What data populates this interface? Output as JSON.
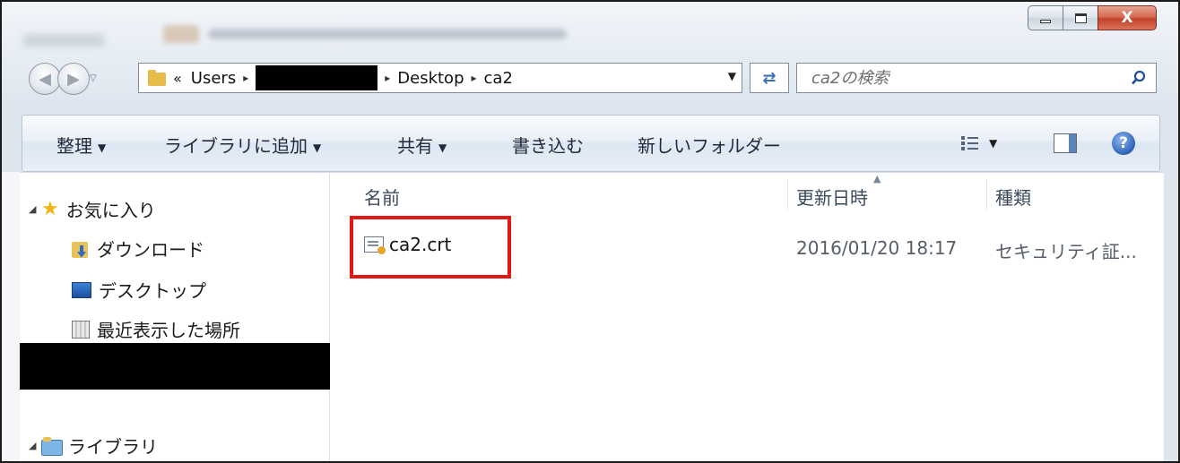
{
  "window": {
    "minimize_label": "",
    "maximize_label": "",
    "close_label": "X"
  },
  "address": {
    "lead": "«",
    "crumbs": [
      "Users",
      "",
      "Desktop",
      "ca2"
    ],
    "separator": "▸"
  },
  "search": {
    "placeholder": "ca2の検索"
  },
  "toolbar": {
    "organize": "整理",
    "add_to_library": "ライブラリに追加",
    "share": "共有",
    "burn": "書き込む",
    "new_folder": "新しいフォルダー",
    "dropdown_glyph": "▼"
  },
  "nav": {
    "favorites": "お気に入り",
    "downloads": "ダウンロード",
    "desktop": "デスクトップ",
    "recent": "最近表示した場所",
    "libraries": "ライブラリ"
  },
  "columns": {
    "name": "名前",
    "modified": "更新日時",
    "type": "種類"
  },
  "files": [
    {
      "name": "ca2.crt",
      "modified": "2016/01/20 18:17",
      "type": "セキュリティ証..."
    }
  ],
  "colors": {
    "highlight": "#e01818",
    "help": "#2d63b8",
    "folder": "#e6bb4a"
  },
  "icons": {
    "back": "back-arrow-icon",
    "forward": "forward-arrow-icon",
    "refresh": "refresh-icon",
    "search": "search-icon",
    "help": "help-icon"
  }
}
